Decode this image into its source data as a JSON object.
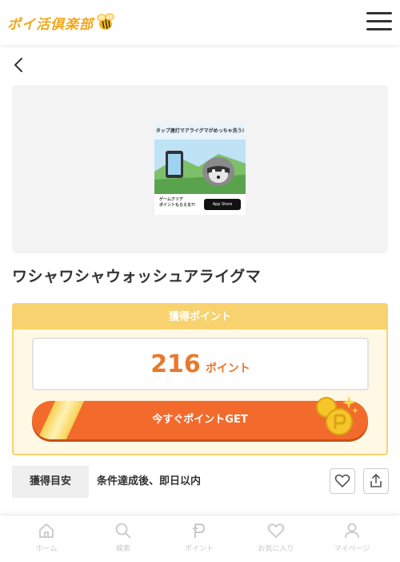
{
  "header": {
    "logo_text": "ポイ活倶楽部",
    "logo_icon": "bee-icon",
    "menu_icon": "hamburger-menu-icon"
  },
  "nav": {
    "back_icon": "chevron-left-icon"
  },
  "banner": {
    "top_caption": "タップ連打でアライグマがめっちゃ洗う!",
    "bottom_caption_line1": "ゲームクリア",
    "bottom_caption_line2": "ポイントもらえる?!",
    "store_badge": "App Store"
  },
  "app": {
    "title": "ワシャワシャウォッシュアライグマ"
  },
  "points": {
    "heading": "獲得ポイント",
    "value": "216",
    "unit": "ポイント",
    "cta_label": "今すぐポイントGET"
  },
  "guide": {
    "label": "獲得目安",
    "value": "条件達成後、即日以内"
  },
  "actions": {
    "favorite_icon": "heart-icon",
    "share_icon": "share-icon"
  },
  "tabbar": {
    "items": [
      {
        "label": "ホーム",
        "icon": "home-icon"
      },
      {
        "label": "検索",
        "icon": "search-icon"
      },
      {
        "label": "ポイント",
        "icon": "point-icon"
      },
      {
        "label": "お気に入り",
        "icon": "heart-icon"
      },
      {
        "label": "マイページ",
        "icon": "user-icon"
      }
    ]
  },
  "colors": {
    "accent_orange": "#f26b2d",
    "point_text": "#e8792c",
    "box_yellow": "#f7d26e",
    "logo_yellow": "#f0a81e"
  }
}
